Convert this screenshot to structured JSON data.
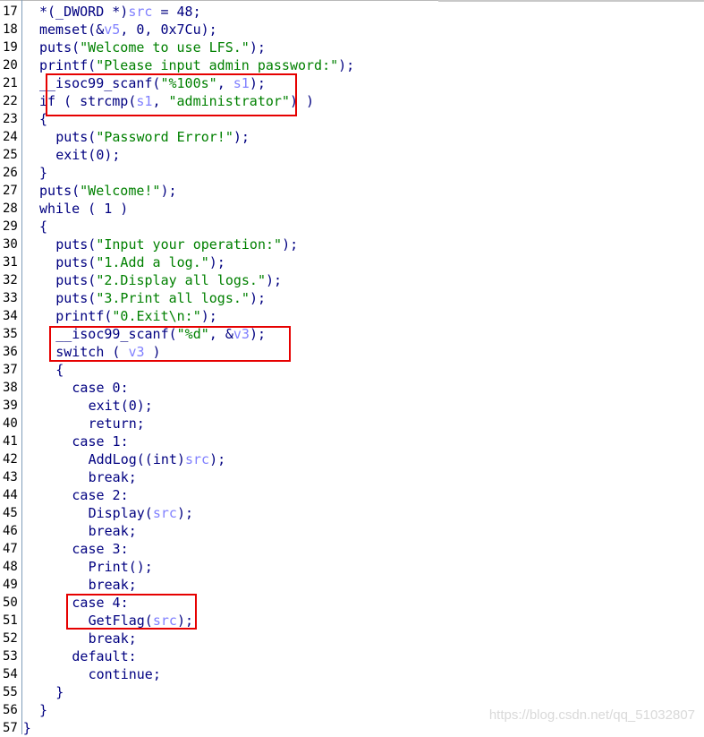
{
  "editor": {
    "lines": [
      {
        "n": "17",
        "indent": 1,
        "tokens": [
          {
            "t": "*(_DWORD *)",
            "c": "default"
          },
          {
            "t": "src",
            "c": "var"
          },
          {
            "t": " = 48;",
            "c": "default"
          }
        ]
      },
      {
        "n": "18",
        "indent": 1,
        "tokens": [
          {
            "t": "memset(&",
            "c": "default"
          },
          {
            "t": "v5",
            "c": "var"
          },
          {
            "t": ", 0, 0x7Cu);",
            "c": "default"
          }
        ]
      },
      {
        "n": "19",
        "indent": 1,
        "tokens": [
          {
            "t": "puts(",
            "c": "default"
          },
          {
            "t": "\"Welcome to use LFS.\"",
            "c": "string"
          },
          {
            "t": ");",
            "c": "default"
          }
        ]
      },
      {
        "n": "20",
        "indent": 1,
        "tokens": [
          {
            "t": "printf(",
            "c": "default"
          },
          {
            "t": "\"Please input admin password:\"",
            "c": "string"
          },
          {
            "t": ");",
            "c": "default"
          }
        ]
      },
      {
        "n": "21",
        "indent": 1,
        "tokens": [
          {
            "t": "__isoc99_scanf(",
            "c": "default"
          },
          {
            "t": "\"%100s\"",
            "c": "string"
          },
          {
            "t": ", ",
            "c": "default"
          },
          {
            "t": "s1",
            "c": "var"
          },
          {
            "t": ");",
            "c": "default"
          }
        ]
      },
      {
        "n": "22",
        "indent": 1,
        "tokens": [
          {
            "t": "if ( strcmp(",
            "c": "default"
          },
          {
            "t": "s1",
            "c": "var"
          },
          {
            "t": ", ",
            "c": "default"
          },
          {
            "t": "\"administrator\"",
            "c": "string"
          },
          {
            "t": ") )",
            "c": "default"
          }
        ]
      },
      {
        "n": "23",
        "indent": 1,
        "tokens": [
          {
            "t": "{",
            "c": "default"
          }
        ]
      },
      {
        "n": "24",
        "indent": 2,
        "tokens": [
          {
            "t": "puts(",
            "c": "default"
          },
          {
            "t": "\"Password Error!\"",
            "c": "string"
          },
          {
            "t": ");",
            "c": "default"
          }
        ]
      },
      {
        "n": "25",
        "indent": 2,
        "tokens": [
          {
            "t": "exit(0);",
            "c": "default"
          }
        ]
      },
      {
        "n": "26",
        "indent": 1,
        "tokens": [
          {
            "t": "}",
            "c": "default"
          }
        ]
      },
      {
        "n": "27",
        "indent": 1,
        "tokens": [
          {
            "t": "puts(",
            "c": "default"
          },
          {
            "t": "\"Welcome!\"",
            "c": "string"
          },
          {
            "t": ");",
            "c": "default"
          }
        ]
      },
      {
        "n": "28",
        "indent": 1,
        "tokens": [
          {
            "t": "while ( 1 )",
            "c": "default"
          }
        ]
      },
      {
        "n": "29",
        "indent": 1,
        "tokens": [
          {
            "t": "{",
            "c": "default"
          }
        ]
      },
      {
        "n": "30",
        "indent": 2,
        "tokens": [
          {
            "t": "puts(",
            "c": "default"
          },
          {
            "t": "\"Input your operation:\"",
            "c": "string"
          },
          {
            "t": ");",
            "c": "default"
          }
        ]
      },
      {
        "n": "31",
        "indent": 2,
        "tokens": [
          {
            "t": "puts(",
            "c": "default"
          },
          {
            "t": "\"1.Add a log.\"",
            "c": "string"
          },
          {
            "t": ");",
            "c": "default"
          }
        ]
      },
      {
        "n": "32",
        "indent": 2,
        "tokens": [
          {
            "t": "puts(",
            "c": "default"
          },
          {
            "t": "\"2.Display all logs.\"",
            "c": "string"
          },
          {
            "t": ");",
            "c": "default"
          }
        ]
      },
      {
        "n": "33",
        "indent": 2,
        "tokens": [
          {
            "t": "puts(",
            "c": "default"
          },
          {
            "t": "\"3.Print all logs.\"",
            "c": "string"
          },
          {
            "t": ");",
            "c": "default"
          }
        ]
      },
      {
        "n": "34",
        "indent": 2,
        "tokens": [
          {
            "t": "printf(",
            "c": "default"
          },
          {
            "t": "\"0.Exit\\n:\"",
            "c": "string"
          },
          {
            "t": ");",
            "c": "default"
          }
        ]
      },
      {
        "n": "35",
        "indent": 2,
        "tokens": [
          {
            "t": "__isoc99_scanf(",
            "c": "default"
          },
          {
            "t": "\"%d\"",
            "c": "string"
          },
          {
            "t": ", &",
            "c": "default"
          },
          {
            "t": "v3",
            "c": "var"
          },
          {
            "t": ");",
            "c": "default"
          }
        ]
      },
      {
        "n": "36",
        "indent": 2,
        "tokens": [
          {
            "t": "switch ( ",
            "c": "default"
          },
          {
            "t": "v3",
            "c": "var"
          },
          {
            "t": " )",
            "c": "default"
          }
        ]
      },
      {
        "n": "37",
        "indent": 2,
        "tokens": [
          {
            "t": "{",
            "c": "default"
          }
        ]
      },
      {
        "n": "38",
        "indent": 3,
        "tokens": [
          {
            "t": "case 0:",
            "c": "default"
          }
        ]
      },
      {
        "n": "39",
        "indent": 4,
        "tokens": [
          {
            "t": "exit(0);",
            "c": "default"
          }
        ]
      },
      {
        "n": "40",
        "indent": 4,
        "tokens": [
          {
            "t": "return;",
            "c": "default"
          }
        ]
      },
      {
        "n": "41",
        "indent": 3,
        "tokens": [
          {
            "t": "case 1:",
            "c": "default"
          }
        ]
      },
      {
        "n": "42",
        "indent": 4,
        "tokens": [
          {
            "t": "AddLog((int)",
            "c": "default"
          },
          {
            "t": "src",
            "c": "var"
          },
          {
            "t": ");",
            "c": "default"
          }
        ]
      },
      {
        "n": "43",
        "indent": 4,
        "tokens": [
          {
            "t": "break;",
            "c": "default"
          }
        ]
      },
      {
        "n": "44",
        "indent": 3,
        "tokens": [
          {
            "t": "case 2:",
            "c": "default"
          }
        ]
      },
      {
        "n": "45",
        "indent": 4,
        "tokens": [
          {
            "t": "Display(",
            "c": "default"
          },
          {
            "t": "src",
            "c": "var"
          },
          {
            "t": ");",
            "c": "default"
          }
        ]
      },
      {
        "n": "46",
        "indent": 4,
        "tokens": [
          {
            "t": "break;",
            "c": "default"
          }
        ]
      },
      {
        "n": "47",
        "indent": 3,
        "tokens": [
          {
            "t": "case 3:",
            "c": "default"
          }
        ]
      },
      {
        "n": "48",
        "indent": 4,
        "tokens": [
          {
            "t": "Print();",
            "c": "default"
          }
        ]
      },
      {
        "n": "49",
        "indent": 4,
        "tokens": [
          {
            "t": "break;",
            "c": "default"
          }
        ]
      },
      {
        "n": "50",
        "indent": 3,
        "tokens": [
          {
            "t": "case 4:",
            "c": "default"
          }
        ]
      },
      {
        "n": "51",
        "indent": 4,
        "tokens": [
          {
            "t": "GetFlag(",
            "c": "default"
          },
          {
            "t": "src",
            "c": "var"
          },
          {
            "t": ");",
            "c": "default"
          }
        ]
      },
      {
        "n": "52",
        "indent": 4,
        "tokens": [
          {
            "t": "break;",
            "c": "default"
          }
        ]
      },
      {
        "n": "53",
        "indent": 3,
        "tokens": [
          {
            "t": "default:",
            "c": "default"
          }
        ]
      },
      {
        "n": "54",
        "indent": 4,
        "tokens": [
          {
            "t": "continue;",
            "c": "default"
          }
        ]
      },
      {
        "n": "55",
        "indent": 2,
        "tokens": [
          {
            "t": "}",
            "c": "default"
          }
        ]
      },
      {
        "n": "56",
        "indent": 1,
        "tokens": [
          {
            "t": "}",
            "c": "default"
          }
        ]
      },
      {
        "n": "57",
        "indent": 0,
        "tokens": [
          {
            "t": "}",
            "c": "default"
          }
        ]
      }
    ]
  },
  "annotation_color": "#e60000",
  "watermark": "https://blog.csdn.net/qq_51032807"
}
